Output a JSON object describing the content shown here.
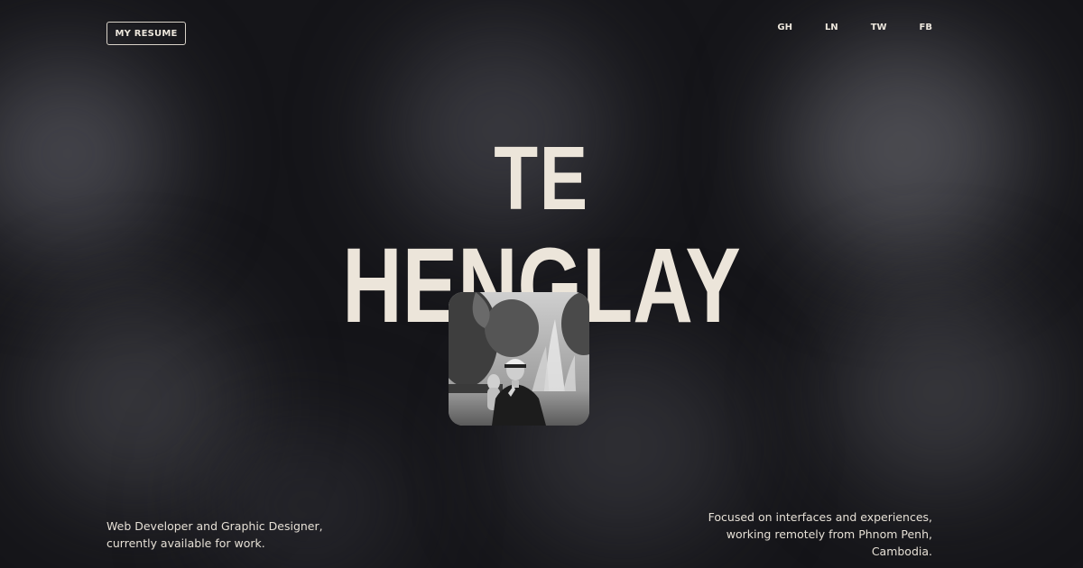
{
  "header": {
    "resume_label": "MY RESUME",
    "social_links": [
      {
        "label": "GH"
      },
      {
        "label": "LN"
      },
      {
        "label": "TW"
      },
      {
        "label": "FB"
      }
    ]
  },
  "hero": {
    "first_name": "TE",
    "last_name": "HENGLAY",
    "photo_icon": "portrait-photo"
  },
  "footer": {
    "left_lines": [
      "Web Developer and Graphic Designer,",
      "currently available for work."
    ],
    "right_lines": [
      "Focused on interfaces and experiences,",
      "working remotely from Phnom Penh,",
      "Cambodia."
    ]
  },
  "colors": {
    "background": "#151519",
    "text": "#ece6dc"
  }
}
